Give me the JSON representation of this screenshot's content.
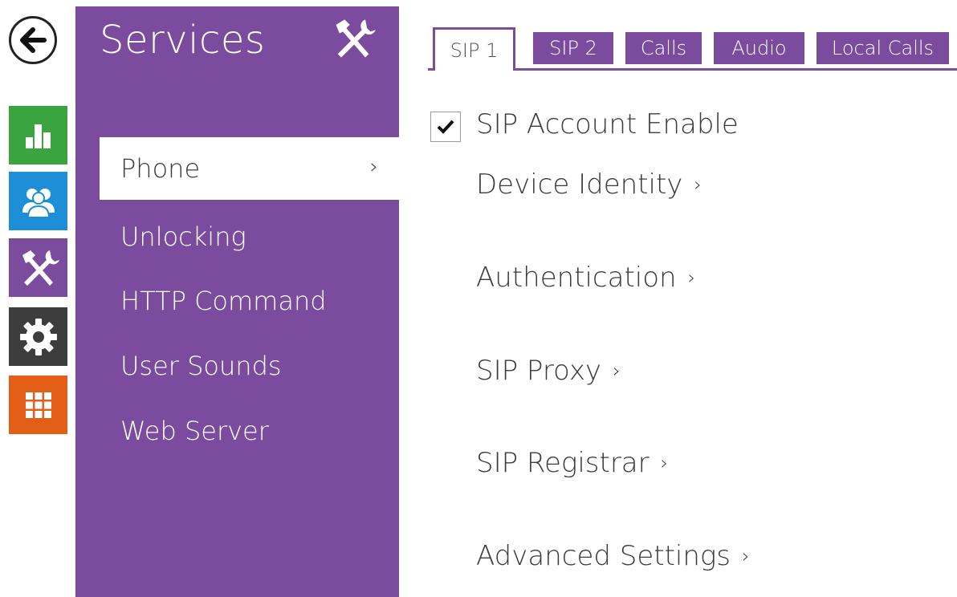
{
  "rail": {
    "back_icon": "arrow-left-icon",
    "items": [
      {
        "name": "status",
        "icon": "bar-chart-icon",
        "color": "#3aa53f"
      },
      {
        "name": "directory",
        "icon": "users-icon",
        "color": "#1e8fd6"
      },
      {
        "name": "services",
        "icon": "tools-icon",
        "color": "#7b4b9e"
      },
      {
        "name": "hardware",
        "icon": "gear-icon",
        "color": "#3d3d3d"
      },
      {
        "name": "system",
        "icon": "grid-icon",
        "color": "#e35f17"
      }
    ]
  },
  "panel": {
    "title": "Services",
    "title_icon": "tools-icon",
    "items": [
      {
        "label": "Phone",
        "active": true,
        "chevron": "›"
      },
      {
        "label": "Unlocking"
      },
      {
        "label": "HTTP Command"
      },
      {
        "label": "User Sounds"
      },
      {
        "label": "Web Server"
      }
    ]
  },
  "tabs": [
    {
      "label": "SIP 1",
      "active": true
    },
    {
      "label": "SIP 2"
    },
    {
      "label": "Calls"
    },
    {
      "label": "Audio"
    },
    {
      "label": "Local Calls"
    }
  ],
  "content": {
    "sip_account_enable": {
      "label": "SIP Account Enable",
      "checked": true
    },
    "sections": [
      {
        "label": "Device Identity",
        "chevron": "›"
      },
      {
        "label": "Authentication",
        "chevron": "›"
      },
      {
        "label": "SIP Proxy",
        "chevron": "›"
      },
      {
        "label": "SIP Registrar",
        "chevron": "›"
      },
      {
        "label": "Advanced Settings",
        "chevron": "›"
      }
    ]
  },
  "colors": {
    "accent": "#7b4b9e",
    "text": "#3b3b3b"
  }
}
